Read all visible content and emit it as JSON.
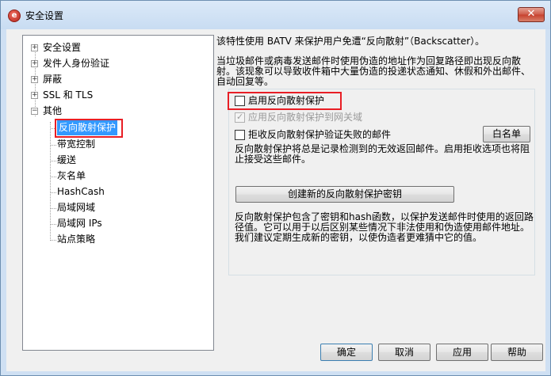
{
  "window": {
    "title": "安全设置",
    "close_glyph": "✕",
    "app_icon": "mdaemon-icon"
  },
  "tree": {
    "collapse_glyph": "−",
    "expand_glyph": "+",
    "items": [
      {
        "label": "安全设置",
        "expander": "+"
      },
      {
        "label": "发件人身份验证",
        "expander": "+"
      },
      {
        "label": "屏蔽",
        "expander": "+"
      },
      {
        "label": "SSL 和 TLS",
        "expander": "+"
      },
      {
        "label": "其他",
        "expander": "−"
      }
    ],
    "children": [
      {
        "label": "反向散射保护",
        "selected": true
      },
      {
        "label": "带宽控制"
      },
      {
        "label": "缓送"
      },
      {
        "label": "灰名单"
      },
      {
        "label": "HashCash"
      },
      {
        "label": "局域网域"
      },
      {
        "label": "局域网 IPs"
      },
      {
        "label": "站点策略"
      }
    ]
  },
  "panel": {
    "intro": "该特性使用 BATV 来保护用户免遭“反向散射”（Backscatter）。",
    "desc_line1": "当垃圾邮件或病毒发送邮件时使用伪造的地址作为回复路径即出现反向散",
    "desc_line2": "射。该现象可以导致收件箱中大量伪造的投递状态通知、休假和外出邮件、",
    "desc_line3": "自动回复等。",
    "enable_label": "启用反向散射保护",
    "enable_checked": false,
    "apply_gateway_label": "应用反向散射保护到网关域",
    "apply_gateway_checked": true,
    "apply_gateway_disabled": true,
    "reject_label": "拒收反向散射保护验证失败的邮件",
    "reject_checked": false,
    "whitelist_button": "白名单",
    "reject_note_line1": "反向散射保护将总是记录检测到的无效返回邮件。启用拒收选项也将阻",
    "reject_note_line2": "止接受这些邮件。",
    "create_key_button": "创建新的反向散射保护密钥",
    "key_note_line1": "反向散射保护包含了密钥和hash函数，以保护发送邮件时使用的返回路",
    "key_note_line2": "径值。它可以用于以后区别某些情况下非法使用和伪造使用邮件地址。",
    "key_note_line3": "我们建议定期生成新的密钥，以使伪造者更难猜中它的值。",
    "check_glyph": "✓"
  },
  "footer": {
    "ok": "确定",
    "cancel": "取消",
    "apply": "应用",
    "help": "帮助"
  },
  "colors": {
    "highlight_box": "#e81e25",
    "selection": "#3399ff"
  }
}
